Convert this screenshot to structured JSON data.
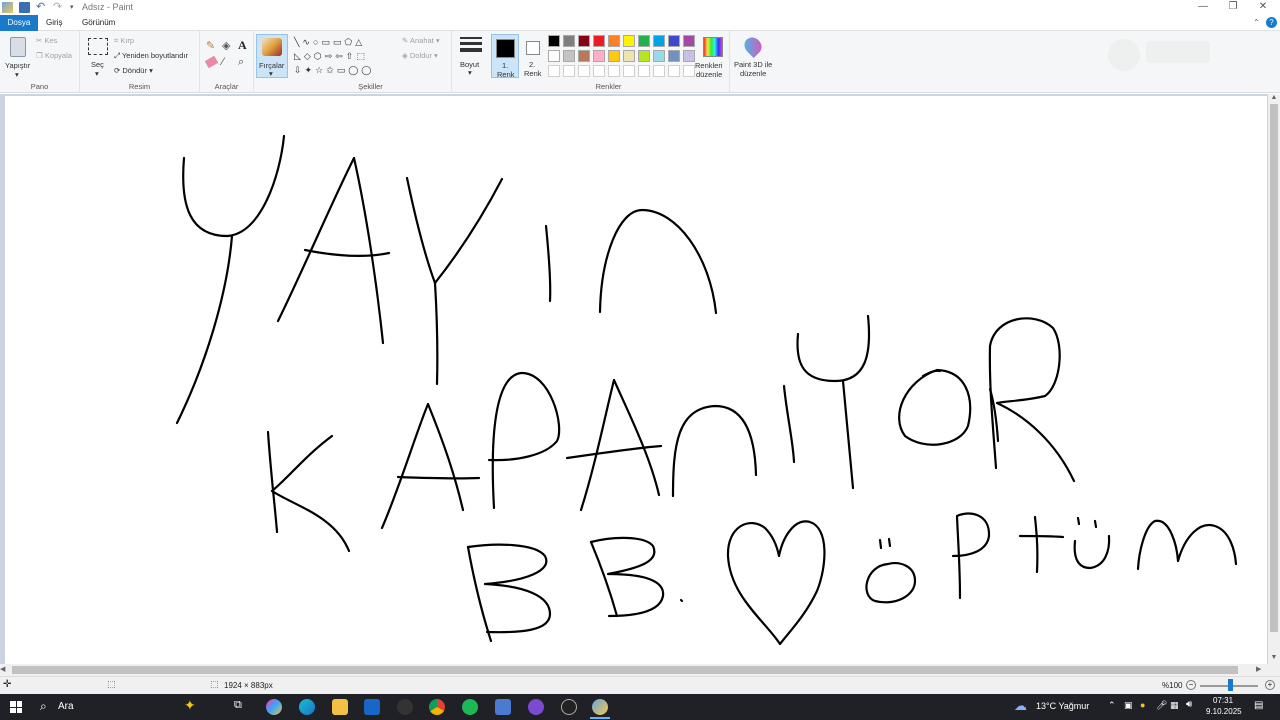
{
  "window": {
    "title": "Adsız - Paint"
  },
  "tabs": [
    {
      "label": "Dosya"
    },
    {
      "label": "Giriş"
    },
    {
      "label": "Görünüm"
    }
  ],
  "ribbon": {
    "clipboard": {
      "paste": "Yapıştır",
      "cut": "Kes",
      "copy": "Kopyala",
      "group": "Pano"
    },
    "image": {
      "select": "Seç",
      "crop": "Kırp",
      "resize": "Yeniden boyutlandır",
      "rotate": "Döndür",
      "group": "Resim"
    },
    "tools": {
      "group": "Araçlar"
    },
    "brushes": {
      "label": "Fırçalar"
    },
    "shapes": {
      "outline": "Anahat",
      "fill": "Doldur",
      "group": "Şekiller"
    },
    "size": {
      "label": "Boyut"
    },
    "colors": {
      "color1_line1": "1.",
      "color1_line2": "Renk",
      "color2_line1": "2.",
      "color2_line2": "Renk",
      "edit_line1": "Renkleri",
      "edit_line2": "düzenle",
      "group": "Renkler",
      "palette_row1": [
        "#000000",
        "#7f7f7f",
        "#880015",
        "#ed1c24",
        "#ff7f27",
        "#fff200",
        "#22b14c",
        "#00a2e8",
        "#3f48cc",
        "#a349a4"
      ],
      "palette_row2": [
        "#ffffff",
        "#c3c3c3",
        "#b97a57",
        "#ffaec9",
        "#ffc90e",
        "#efe4b0",
        "#b5e61d",
        "#99d9ea",
        "#7092be",
        "#c8bfe7"
      ]
    },
    "paint3d": {
      "line1": "Paint 3D ile",
      "line2": "düzenle"
    }
  },
  "drawing": {
    "line1": "YAYIN",
    "line2": "KAPANIYOR",
    "line3": "BB ♡ ÖPTÜM"
  },
  "status": {
    "canvas_size": "1924 × 883px",
    "zoom": "%100"
  },
  "taskbar": {
    "search": "Ara",
    "weather": "13°C  Yağmur",
    "time": "07:31",
    "date": "9.10.2025"
  }
}
